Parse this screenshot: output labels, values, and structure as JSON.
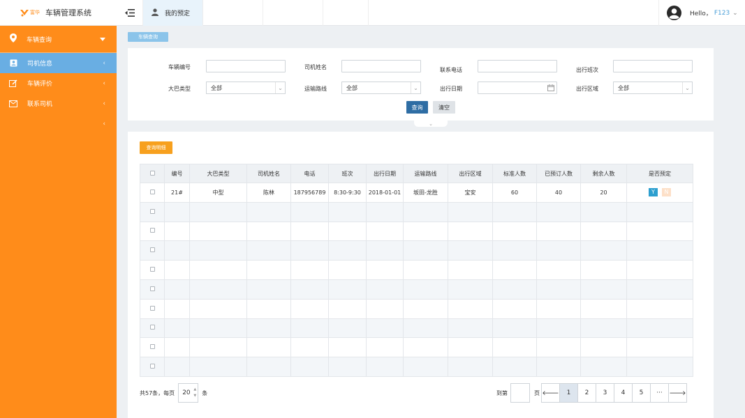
{
  "app": {
    "logo_text": "富华",
    "title": "车辆管理系统"
  },
  "sidebar": {
    "section_label": "车辆查询",
    "items": [
      {
        "label": "司机信息",
        "active": true,
        "icon": "id-card-icon"
      },
      {
        "label": "车辆评价",
        "active": false,
        "icon": "edit-icon"
      },
      {
        "label": "联系司机",
        "active": false,
        "icon": "envelope-icon"
      }
    ]
  },
  "topbar": {
    "active_tab": "我的预定",
    "greeting": "Hello，",
    "username": "F123"
  },
  "breadcrumb": "车辆查询",
  "search": {
    "fields": {
      "vehicle_no": {
        "label": "车辆编号",
        "value": ""
      },
      "driver_name": {
        "label": "司机姓名",
        "value": ""
      },
      "phone": {
        "label": "联系电话",
        "value": ""
      },
      "shift": {
        "label": "出行班次",
        "value": ""
      },
      "bus_type": {
        "label": "大巴类型",
        "value": "全部"
      },
      "route": {
        "label": "运输路线",
        "value": "全部"
      },
      "date": {
        "label": "出行日期",
        "value": ""
      },
      "area": {
        "label": "出行区域",
        "value": "全部"
      }
    },
    "search_button": "查询",
    "clear_button": "清空"
  },
  "results": {
    "detail_button": "查询明细",
    "columns": [
      "编号",
      "大巴类型",
      "司机姓名",
      "电话",
      "班次",
      "出行日期",
      "运输路线",
      "出行区域",
      "标准人数",
      "已预订人数",
      "剩余人数",
      "是否预定"
    ],
    "rows": [
      {
        "id": "21#",
        "bus_type": "中型",
        "driver": "陈林",
        "phone": "187956789",
        "shift": "8:30-9:30",
        "date": "2018-01-01",
        "route": "坂田-龙胜",
        "area": "宝安",
        "standard": "60",
        "booked": "40",
        "remaining": "20",
        "yes": "Y",
        "no": "N"
      }
    ],
    "empty_rows": 9,
    "colors": {
      "header_bg": "#eef1f4",
      "yes_badge": "#2d9fcf",
      "no_badge": "#fde0c8"
    }
  },
  "pagination": {
    "total_prefix": "共57条，每页",
    "page_size": "20",
    "total_suffix": "条",
    "jump_prefix": "到第",
    "jump_suffix": "页",
    "prev_icon": "arrow-left-icon",
    "next_icon": "arrow-right-icon",
    "pages": [
      "1",
      "2",
      "3",
      "4",
      "5",
      "···"
    ],
    "current": "1"
  },
  "colors": {
    "sidebar": "#ff8c1a",
    "active_item": "#69aee3",
    "primary": "#2e6da4",
    "accent": "#f7a01e"
  }
}
